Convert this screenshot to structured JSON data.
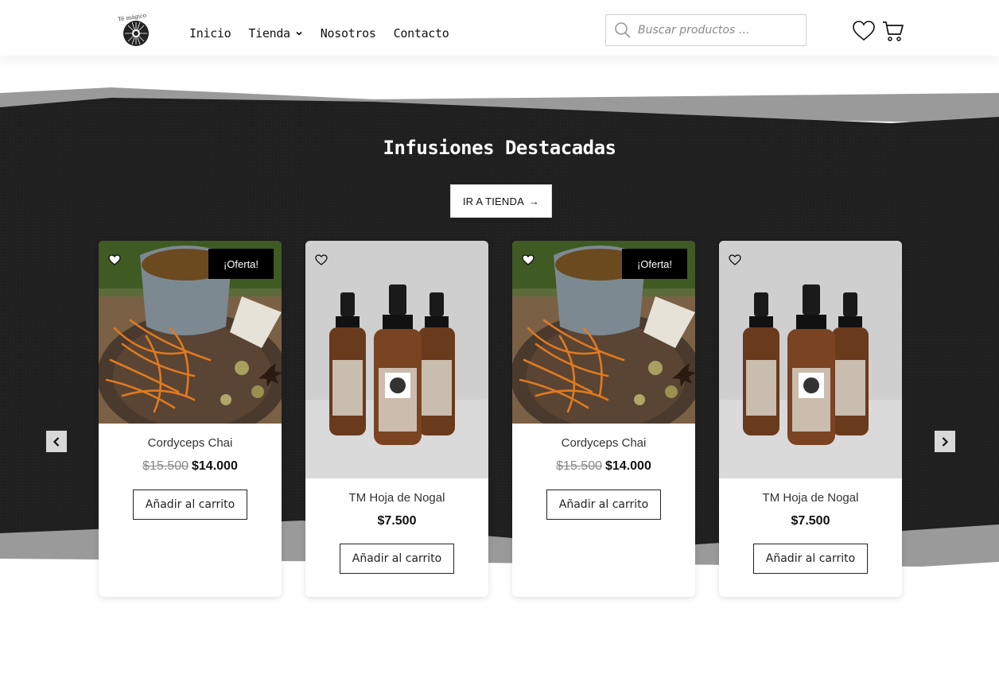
{
  "header": {
    "logo_text": "Té mágico",
    "nav": [
      {
        "label": "Inicio"
      },
      {
        "label": "Tienda",
        "has_dropdown": true
      },
      {
        "label": "Nosotros"
      },
      {
        "label": "Contacto"
      }
    ],
    "search_placeholder": "Buscar productos …"
  },
  "section": {
    "title": "Infusiones Destacadas",
    "cta_label": "IR A TIENDA",
    "cta_arrow": "→"
  },
  "products": [
    {
      "name": "Cordyceps Chai",
      "old_price": "$15.500",
      "price": "$14.000",
      "badge": "¡Oferta!",
      "button": "Añadir al carrito",
      "image": "tea-cup-cordyceps"
    },
    {
      "name": "TM Hoja de Nogal",
      "old_price": "",
      "price": "$7.500",
      "badge": "",
      "button": "Añadir al carrito",
      "image": "tincture-bottles"
    },
    {
      "name": "Cordyceps Chai",
      "old_price": "$15.500",
      "price": "$14.000",
      "badge": "¡Oferta!",
      "button": "Añadir al carrito",
      "image": "tea-cup-cordyceps"
    },
    {
      "name": "TM Hoja de Nogal",
      "old_price": "",
      "price": "$7.500",
      "badge": "",
      "button": "Añadir al carrito",
      "image": "tincture-bottles"
    }
  ],
  "colors": {
    "dark_band": "#1f1f1f",
    "gray_edge": "#9a9a9a",
    "accent": "#000000"
  },
  "icons": [
    "search-icon",
    "heart-icon",
    "cart-icon",
    "chevron-left-icon",
    "chevron-right-icon"
  ]
}
